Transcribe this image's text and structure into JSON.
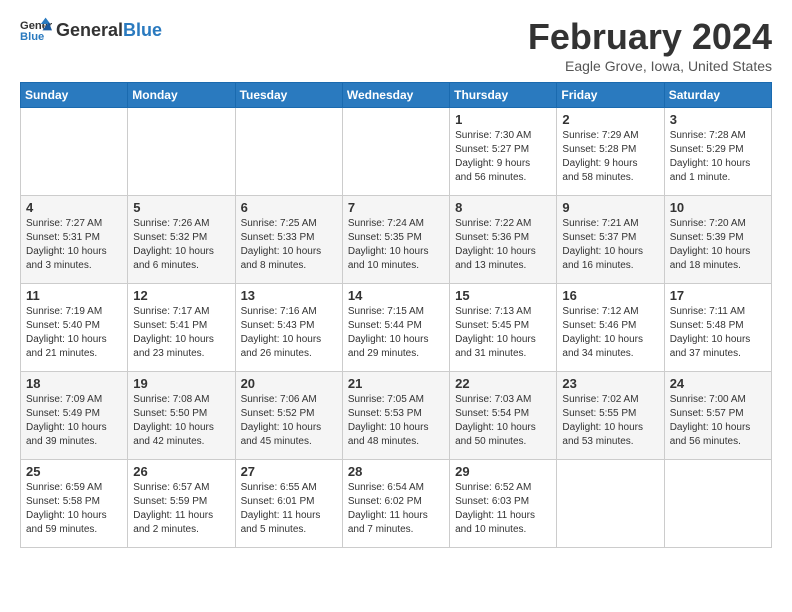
{
  "header": {
    "logo_general": "General",
    "logo_blue": "Blue",
    "title": "February 2024",
    "subtitle": "Eagle Grove, Iowa, United States"
  },
  "days_of_week": [
    "Sunday",
    "Monday",
    "Tuesday",
    "Wednesday",
    "Thursday",
    "Friday",
    "Saturday"
  ],
  "weeks": [
    [
      {
        "day": "",
        "info": ""
      },
      {
        "day": "",
        "info": ""
      },
      {
        "day": "",
        "info": ""
      },
      {
        "day": "",
        "info": ""
      },
      {
        "day": "1",
        "info": "Sunrise: 7:30 AM\nSunset: 5:27 PM\nDaylight: 9 hours\nand 56 minutes."
      },
      {
        "day": "2",
        "info": "Sunrise: 7:29 AM\nSunset: 5:28 PM\nDaylight: 9 hours\nand 58 minutes."
      },
      {
        "day": "3",
        "info": "Sunrise: 7:28 AM\nSunset: 5:29 PM\nDaylight: 10 hours\nand 1 minute."
      }
    ],
    [
      {
        "day": "4",
        "info": "Sunrise: 7:27 AM\nSunset: 5:31 PM\nDaylight: 10 hours\nand 3 minutes."
      },
      {
        "day": "5",
        "info": "Sunrise: 7:26 AM\nSunset: 5:32 PM\nDaylight: 10 hours\nand 6 minutes."
      },
      {
        "day": "6",
        "info": "Sunrise: 7:25 AM\nSunset: 5:33 PM\nDaylight: 10 hours\nand 8 minutes."
      },
      {
        "day": "7",
        "info": "Sunrise: 7:24 AM\nSunset: 5:35 PM\nDaylight: 10 hours\nand 10 minutes."
      },
      {
        "day": "8",
        "info": "Sunrise: 7:22 AM\nSunset: 5:36 PM\nDaylight: 10 hours\nand 13 minutes."
      },
      {
        "day": "9",
        "info": "Sunrise: 7:21 AM\nSunset: 5:37 PM\nDaylight: 10 hours\nand 16 minutes."
      },
      {
        "day": "10",
        "info": "Sunrise: 7:20 AM\nSunset: 5:39 PM\nDaylight: 10 hours\nand 18 minutes."
      }
    ],
    [
      {
        "day": "11",
        "info": "Sunrise: 7:19 AM\nSunset: 5:40 PM\nDaylight: 10 hours\nand 21 minutes."
      },
      {
        "day": "12",
        "info": "Sunrise: 7:17 AM\nSunset: 5:41 PM\nDaylight: 10 hours\nand 23 minutes."
      },
      {
        "day": "13",
        "info": "Sunrise: 7:16 AM\nSunset: 5:43 PM\nDaylight: 10 hours\nand 26 minutes."
      },
      {
        "day": "14",
        "info": "Sunrise: 7:15 AM\nSunset: 5:44 PM\nDaylight: 10 hours\nand 29 minutes."
      },
      {
        "day": "15",
        "info": "Sunrise: 7:13 AM\nSunset: 5:45 PM\nDaylight: 10 hours\nand 31 minutes."
      },
      {
        "day": "16",
        "info": "Sunrise: 7:12 AM\nSunset: 5:46 PM\nDaylight: 10 hours\nand 34 minutes."
      },
      {
        "day": "17",
        "info": "Sunrise: 7:11 AM\nSunset: 5:48 PM\nDaylight: 10 hours\nand 37 minutes."
      }
    ],
    [
      {
        "day": "18",
        "info": "Sunrise: 7:09 AM\nSunset: 5:49 PM\nDaylight: 10 hours\nand 39 minutes."
      },
      {
        "day": "19",
        "info": "Sunrise: 7:08 AM\nSunset: 5:50 PM\nDaylight: 10 hours\nand 42 minutes."
      },
      {
        "day": "20",
        "info": "Sunrise: 7:06 AM\nSunset: 5:52 PM\nDaylight: 10 hours\nand 45 minutes."
      },
      {
        "day": "21",
        "info": "Sunrise: 7:05 AM\nSunset: 5:53 PM\nDaylight: 10 hours\nand 48 minutes."
      },
      {
        "day": "22",
        "info": "Sunrise: 7:03 AM\nSunset: 5:54 PM\nDaylight: 10 hours\nand 50 minutes."
      },
      {
        "day": "23",
        "info": "Sunrise: 7:02 AM\nSunset: 5:55 PM\nDaylight: 10 hours\nand 53 minutes."
      },
      {
        "day": "24",
        "info": "Sunrise: 7:00 AM\nSunset: 5:57 PM\nDaylight: 10 hours\nand 56 minutes."
      }
    ],
    [
      {
        "day": "25",
        "info": "Sunrise: 6:59 AM\nSunset: 5:58 PM\nDaylight: 10 hours\nand 59 minutes."
      },
      {
        "day": "26",
        "info": "Sunrise: 6:57 AM\nSunset: 5:59 PM\nDaylight: 11 hours\nand 2 minutes."
      },
      {
        "day": "27",
        "info": "Sunrise: 6:55 AM\nSunset: 6:01 PM\nDaylight: 11 hours\nand 5 minutes."
      },
      {
        "day": "28",
        "info": "Sunrise: 6:54 AM\nSunset: 6:02 PM\nDaylight: 11 hours\nand 7 minutes."
      },
      {
        "day": "29",
        "info": "Sunrise: 6:52 AM\nSunset: 6:03 PM\nDaylight: 11 hours\nand 10 minutes."
      },
      {
        "day": "",
        "info": ""
      },
      {
        "day": "",
        "info": ""
      }
    ]
  ]
}
